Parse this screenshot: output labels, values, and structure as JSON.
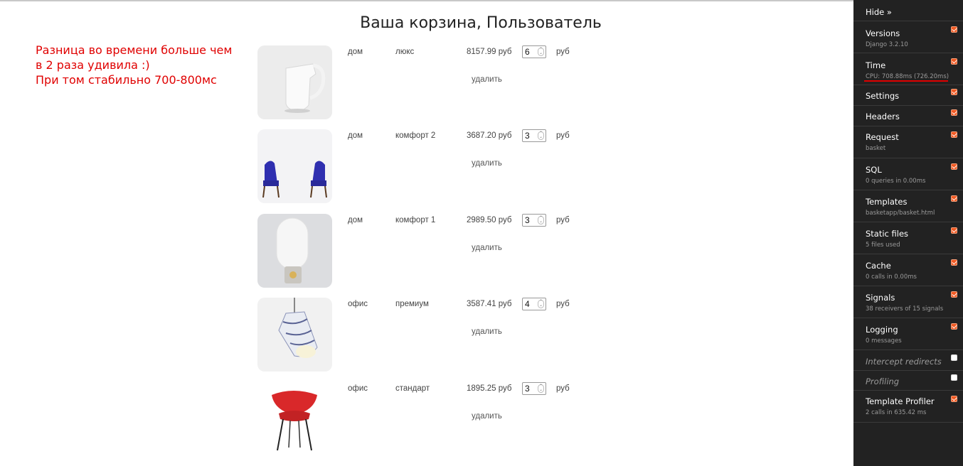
{
  "header": {
    "title": "Ваша корзина, Пользователь"
  },
  "note": {
    "lines": [
      "Разница во времени больше чем",
      "в 2 раза удивила :)",
      "При том стабильно 700-800мс"
    ]
  },
  "basket": {
    "currency": "руб",
    "remove_label": "удалить",
    "items": [
      {
        "category": "дом",
        "name": "люкс",
        "price": "8157.99 руб",
        "quantity": "6",
        "image": "white-jug"
      },
      {
        "category": "дом",
        "name": "комфорт 2",
        "price": "3687.20 руб",
        "quantity": "3",
        "image": "blue-chairs"
      },
      {
        "category": "дом",
        "name": "комфорт 1",
        "price": "2989.50 руб",
        "quantity": "3",
        "image": "white-lamp"
      },
      {
        "category": "офис",
        "name": "премиум",
        "price": "3587.41 руб",
        "quantity": "4",
        "image": "pendant-lamp"
      },
      {
        "category": "офис",
        "name": "стандарт",
        "price": "1895.25 руб",
        "quantity": "3",
        "image": "red-chair"
      }
    ]
  },
  "toolbar": {
    "hide_label": "Hide »",
    "accent_color": "#f15a24",
    "panels": [
      {
        "title": "Versions",
        "subtitle": "Django 3.2.10",
        "enabled": true
      },
      {
        "title": "Time",
        "subtitle": "CPU: 708.88ms (726.20ms)",
        "enabled": true
      },
      {
        "title": "Settings",
        "subtitle": "",
        "enabled": true
      },
      {
        "title": "Headers",
        "subtitle": "",
        "enabled": true
      },
      {
        "title": "Request",
        "subtitle": "basket",
        "enabled": true
      },
      {
        "title": "SQL",
        "subtitle": "0 queries in 0.00ms",
        "enabled": true
      },
      {
        "title": "Templates",
        "subtitle": "basketapp/basket.html",
        "enabled": true
      },
      {
        "title": "Static files",
        "subtitle": "5 files used",
        "enabled": true
      },
      {
        "title": "Cache",
        "subtitle": "0 calls in 0.00ms",
        "enabled": true
      },
      {
        "title": "Signals",
        "subtitle": "38 receivers of 15 signals",
        "enabled": true
      },
      {
        "title": "Logging",
        "subtitle": "0 messages",
        "enabled": true
      },
      {
        "title": "Intercept redirects",
        "subtitle": "",
        "enabled": false
      },
      {
        "title": "Profiling",
        "subtitle": "",
        "enabled": false
      },
      {
        "title": "Template Profiler",
        "subtitle": "2 calls in 635.42 ms",
        "enabled": true
      }
    ]
  }
}
